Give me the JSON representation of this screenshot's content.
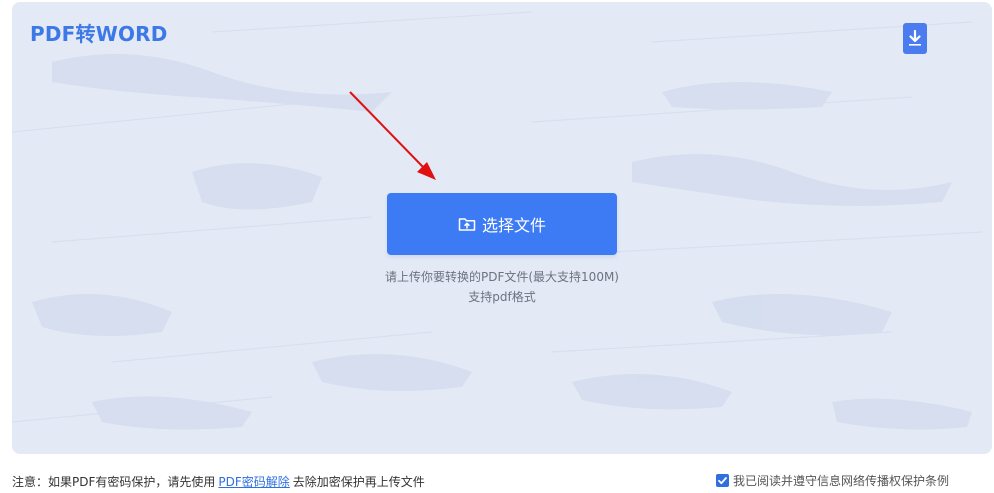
{
  "app": {
    "title": "PDF转WORD"
  },
  "header": {
    "download_icon": "download-icon"
  },
  "upload": {
    "button_label": "选择文件",
    "button_icon": "folder-upload-icon",
    "hint_line1": "请上传你要转换的PDF文件(最大支持100M)",
    "hint_line2": "支持pdf格式"
  },
  "footer": {
    "note_prefix": "注意：如果PDF有密码保护，请先使用",
    "note_link": "PDF密码解除",
    "note_suffix": "去除加密保护再上传文件",
    "agreement_label": "我已阅读并遵守信息网络传播权保护条例",
    "agreement_checked": true
  },
  "colors": {
    "accent": "#3d7bf5",
    "title": "#3c78e6",
    "panel_bg": "#e4eaf5",
    "arrow": "#e01010"
  }
}
